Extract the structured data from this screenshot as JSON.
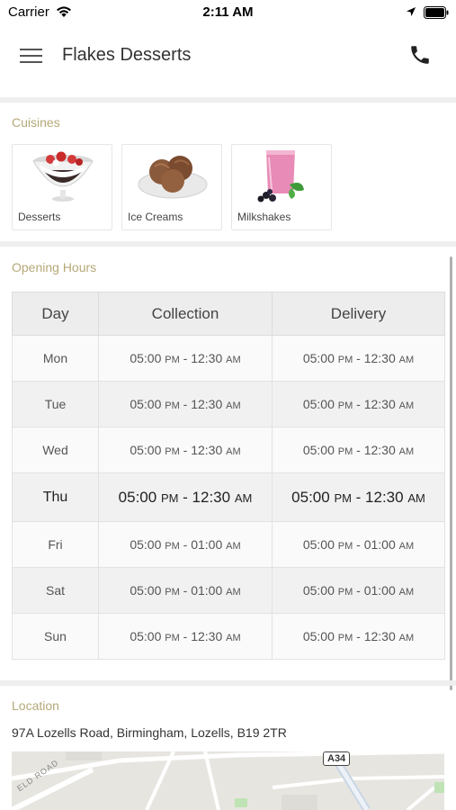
{
  "status_bar": {
    "carrier": "Carrier",
    "time": "2:11 AM"
  },
  "header": {
    "title": "Flakes Desserts",
    "menu_icon": "hamburger-menu-icon",
    "phone_icon": "phone-icon"
  },
  "cuisines": {
    "label": "Cuisines",
    "items": [
      {
        "label": "Desserts",
        "icon": "dessert-bowl-image"
      },
      {
        "label": "Ice Creams",
        "icon": "ice-cream-scoops-image"
      },
      {
        "label": "Milkshakes",
        "icon": "milkshake-glass-image"
      }
    ]
  },
  "opening_hours": {
    "label": "Opening Hours",
    "headers": [
      "Day",
      "Collection",
      "Delivery"
    ],
    "rows": [
      {
        "day": "Mon",
        "col_start": "05:00",
        "col_start_ampm": "PM",
        "col_end": "12:30",
        "col_end_ampm": "AM",
        "del_start": "05:00",
        "del_start_ampm": "PM",
        "del_end": "12:30",
        "del_end_ampm": "AM"
      },
      {
        "day": "Tue",
        "col_start": "05:00",
        "col_start_ampm": "PM",
        "col_end": "12:30",
        "col_end_ampm": "AM",
        "del_start": "05:00",
        "del_start_ampm": "PM",
        "del_end": "12:30",
        "del_end_ampm": "AM"
      },
      {
        "day": "Wed",
        "col_start": "05:00",
        "col_start_ampm": "PM",
        "col_end": "12:30",
        "col_end_ampm": "AM",
        "del_start": "05:00",
        "del_start_ampm": "PM",
        "del_end": "12:30",
        "del_end_ampm": "AM"
      },
      {
        "day": "Thu",
        "col_start": "05:00",
        "col_start_ampm": "PM",
        "col_end": "12:30",
        "col_end_ampm": "AM",
        "del_start": "05:00",
        "del_start_ampm": "PM",
        "del_end": "12:30",
        "del_end_ampm": "AM"
      },
      {
        "day": "Fri",
        "col_start": "05:00",
        "col_start_ampm": "PM",
        "col_end": "01:00",
        "col_end_ampm": "AM",
        "del_start": "05:00",
        "del_start_ampm": "PM",
        "del_end": "01:00",
        "del_end_ampm": "AM"
      },
      {
        "day": "Sat",
        "col_start": "05:00",
        "col_start_ampm": "PM",
        "col_end": "01:00",
        "col_end_ampm": "AM",
        "del_start": "05:00",
        "del_start_ampm": "PM",
        "del_end": "01:00",
        "del_end_ampm": "AM"
      },
      {
        "day": "Sun",
        "col_start": "05:00",
        "col_start_ampm": "PM",
        "col_end": "12:30",
        "col_end_ampm": "AM",
        "del_start": "05:00",
        "del_start_ampm": "PM",
        "del_end": "12:30",
        "del_end_ampm": "AM"
      }
    ]
  },
  "location": {
    "label": "Location",
    "address": "97A Lozells Road, Birmingham, Lozells, B19 2TR",
    "map_road_sign": "A34",
    "map_street_label": "ELD ROAD"
  },
  "colors": {
    "section_label": "#b5a878",
    "divider": "#eeeeee",
    "table_header_bg": "#ededed"
  }
}
